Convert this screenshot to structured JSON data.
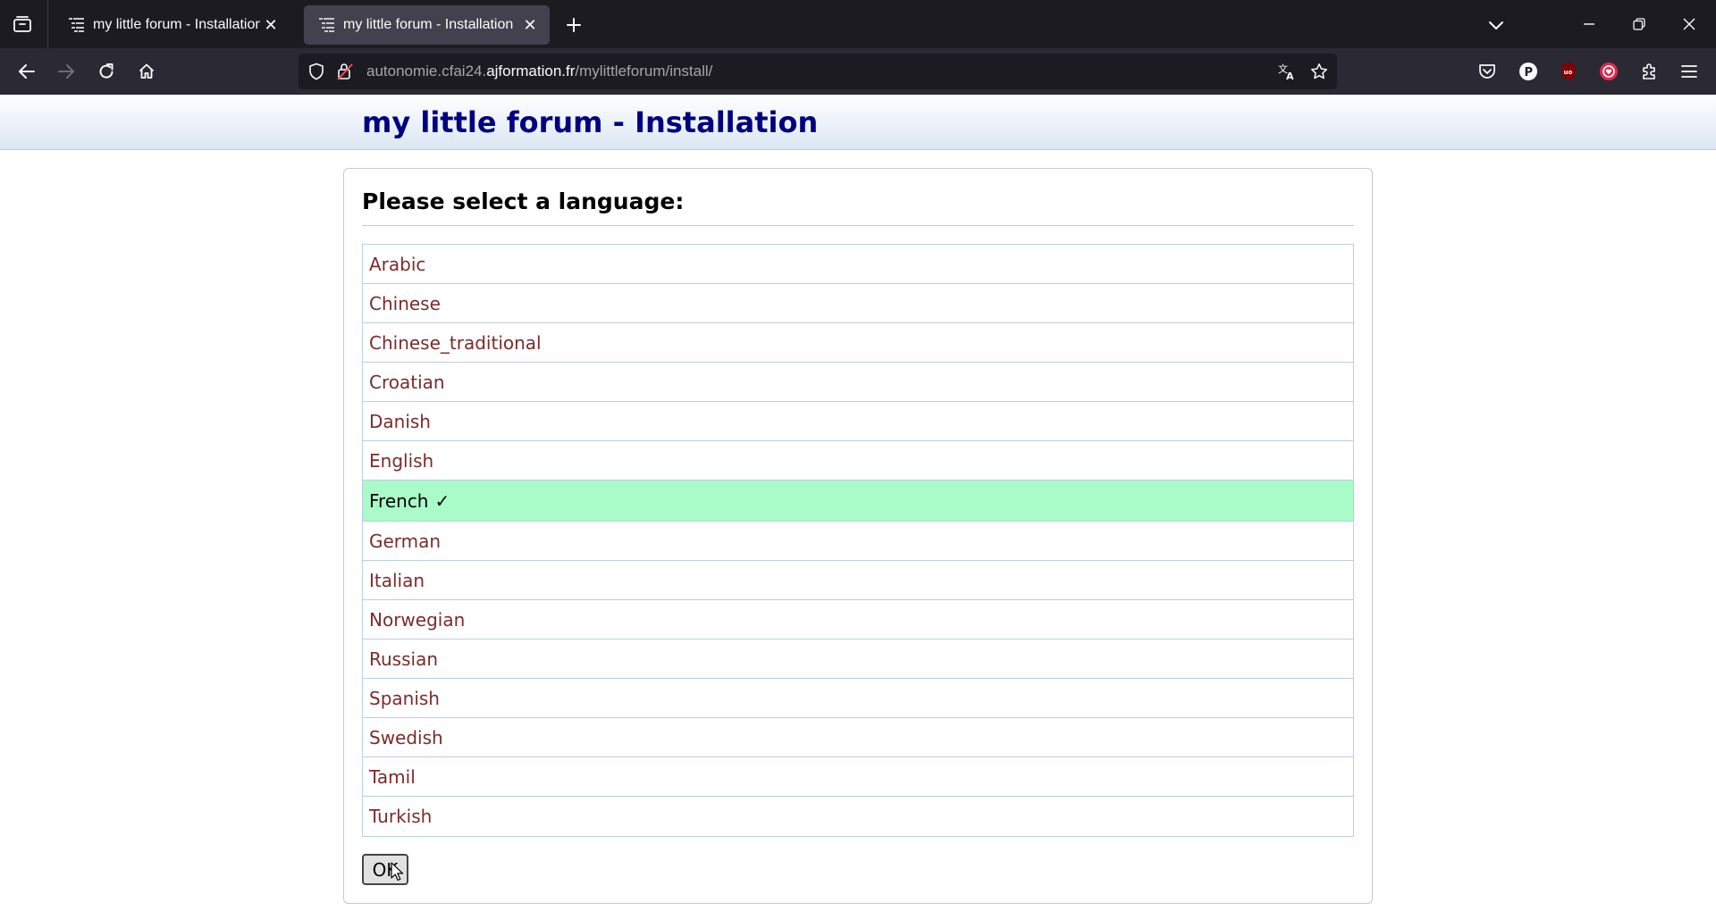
{
  "browser": {
    "tabs": [
      {
        "title": "my little forum - Installation",
        "active": false
      },
      {
        "title": "my little forum - Installation",
        "active": true
      }
    ],
    "url": {
      "prefix": "autonomie.cfai24.",
      "host": "ajformation.fr",
      "path": "/mylittleforum/install/"
    },
    "colors": {
      "tabbar": "#1c1b22",
      "navbar": "#2b2a33",
      "active_tab": "#42414d"
    }
  },
  "page": {
    "header_title": "my little forum - Installation",
    "prompt": "Please select a language:",
    "languages": [
      {
        "label": "Arabic",
        "selected": false
      },
      {
        "label": "Chinese",
        "selected": false
      },
      {
        "label": "Chinese_traditional",
        "selected": false
      },
      {
        "label": "Croatian",
        "selected": false
      },
      {
        "label": "Danish",
        "selected": false
      },
      {
        "label": "English",
        "selected": false
      },
      {
        "label": "French",
        "selected": true,
        "mark": "✓"
      },
      {
        "label": "German",
        "selected": false
      },
      {
        "label": "Italian",
        "selected": false
      },
      {
        "label": "Norwegian",
        "selected": false
      },
      {
        "label": "Russian",
        "selected": false
      },
      {
        "label": "Spanish",
        "selected": false
      },
      {
        "label": "Swedish",
        "selected": false
      },
      {
        "label": "Tamil",
        "selected": false
      },
      {
        "label": "Turkish",
        "selected": false
      }
    ],
    "ok_label": "OK",
    "colors": {
      "title": "#000080",
      "link": "#7b2b2b",
      "selected_bg": "#a9fcc7"
    }
  }
}
